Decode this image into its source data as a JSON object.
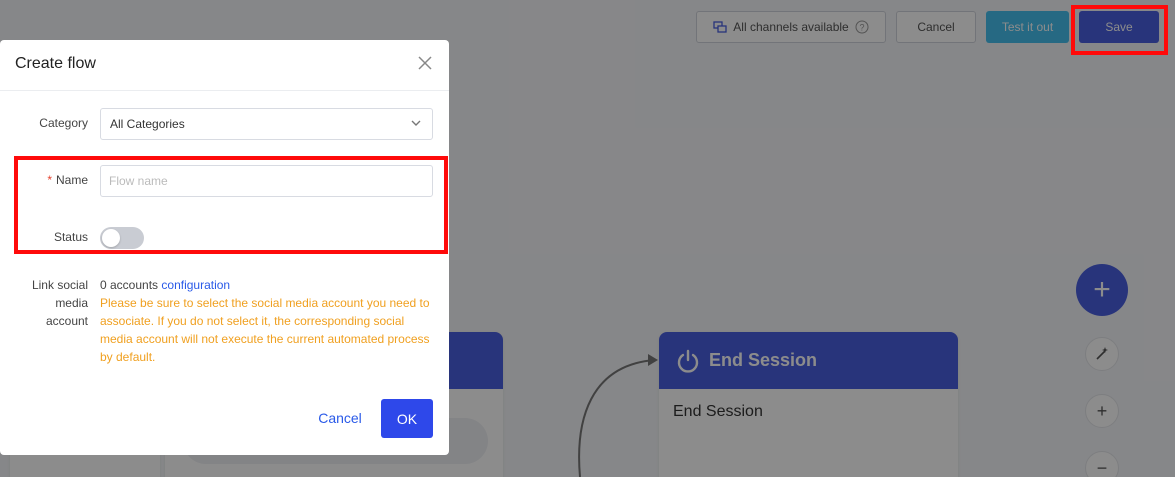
{
  "topbar": {
    "channels_label": "All channels available",
    "cancel_label": "Cancel",
    "test_label": "Test it out",
    "save_label": "Save"
  },
  "canvas": {
    "end_node_title": "End Session",
    "end_node_body": "End Session",
    "fab_icon": "plus-icon",
    "tools": [
      "magic-wand-icon",
      "zoom-in-icon",
      "zoom-out-icon"
    ]
  },
  "dialog": {
    "title": "Create flow",
    "category_label": "Category",
    "category_value": "All Categories",
    "name_label": "Name",
    "name_required_mark": "*",
    "name_placeholder": "Flow name",
    "status_label": "Status",
    "status_on": false,
    "link_label": "Link social media account",
    "accounts_text": "0 accounts",
    "config_link": "configuration",
    "warning": "Please be sure to select the social media account you need to associate. If you do not select it, the corresponding social media account will not execute the current automated process by default.",
    "cancel_label": "Cancel",
    "ok_label": "OK"
  },
  "colors": {
    "primary": "#4a5fe0",
    "ok_button": "#2e48ea",
    "test_button": "#46c0ef",
    "highlight": "#ff0a0a",
    "warning_text": "#f0a020",
    "link": "#2a5ae8"
  }
}
